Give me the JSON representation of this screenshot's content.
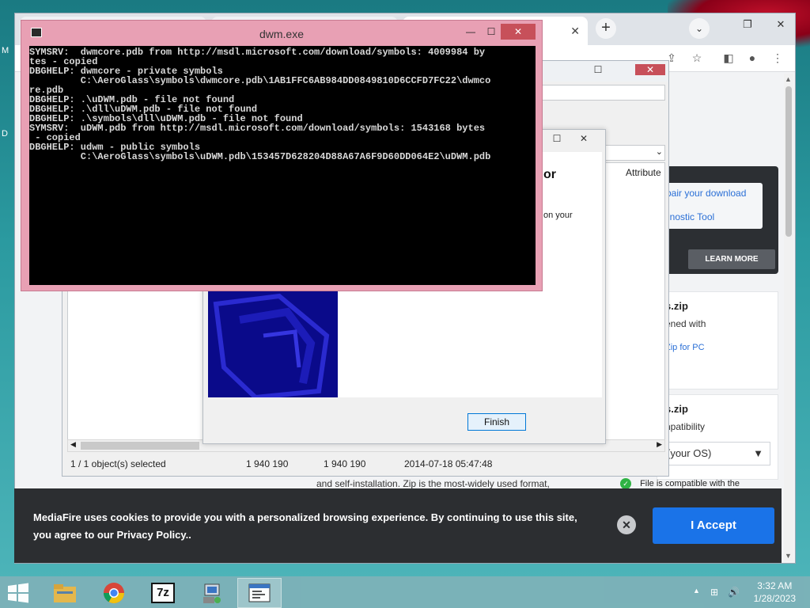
{
  "desktop": {
    "left_labels": [
      "M",
      "D"
    ]
  },
  "chrome": {
    "tabs": [
      {
        "label": ""
      },
      {
        "label": ""
      },
      {
        "label": ""
      }
    ],
    "new_tab": "+",
    "tab_search": "⌄",
    "window_controls": {
      "minimize": "—",
      "maximize": "❐",
      "close": "✕"
    }
  },
  "mediafire": {
    "ad_links": [
      "pair your download",
      "gnostic Tool"
    ],
    "learn_more": "LEARN MORE",
    "card1": {
      "title": "s.zip",
      "text": "ened with",
      "link": "Zip for PC"
    },
    "card2": {
      "title": "s.zip",
      "text": "npatibility"
    },
    "os_select": {
      "value": "(your OS)"
    },
    "compat_text": "File is compatible with the",
    "description": "and self-installation. Zip is the most-widely used format,"
  },
  "cookie_banner": {
    "text": "MediaFire uses cookies to provide you with a personalized browsing experience. By continuing to use this site, you agree to our Privacy Policy..",
    "close": "✕",
    "accept": "I Accept"
  },
  "file_manager": {
    "window_controls": {
      "maximize": "☐",
      "close": "✕"
    },
    "column_attributes": "Attribute",
    "status": {
      "selected": "1 / 1 object(s) selected",
      "size": "1 940 190",
      "packed": "1 940 190",
      "modified": "2014-07-18 05:47:48"
    }
  },
  "installer_dialog": {
    "window_controls": {
      "maximize": "☐",
      "close": "✕"
    },
    "heading_fragment": "or",
    "sub_fragment": "on your",
    "finish": "Finish"
  },
  "console": {
    "title": "dwm.exe",
    "window_controls": {
      "minimize": "—",
      "maximize": "☐",
      "close": "✕"
    },
    "lines": [
      "SYMSRV:  dwmcore.pdb from http://msdl.microsoft.com/download/symbols: 4009984 by",
      "tes - copied",
      "DBGHELP: dwmcore - private symbols",
      "         C:\\AeroGlass\\symbols\\dwmcore.pdb\\1AB1FFC6AB984DD0849810D6CCFD7FC22\\dwmco",
      "re.pdb",
      "DBGHELP: .\\uDWM.pdb - file not found",
      "DBGHELP: .\\dll\\uDWM.pdb - file not found",
      "DBGHELP: .\\symbols\\dll\\uDWM.pdb - file not found",
      "SYMSRV:  uDWM.pdb from http://msdl.microsoft.com/download/symbols: 1543168 bytes",
      " - copied",
      "DBGHELP: udwm - public symbols",
      "         C:\\AeroGlass\\symbols\\uDWM.pdb\\153457D628204D88A67A6F9D60DD064E2\\uDWM.pdb"
    ]
  },
  "taskbar": {
    "apps": [
      "file-explorer",
      "chrome",
      "7-zip",
      "installer",
      "notepad"
    ],
    "sevenzip_label": "7z",
    "clock": {
      "time": "3:32 AM",
      "date": "1/28/2023"
    },
    "tray": {
      "show_hidden": "▲",
      "network": "⊞",
      "volume": "🔊"
    }
  }
}
